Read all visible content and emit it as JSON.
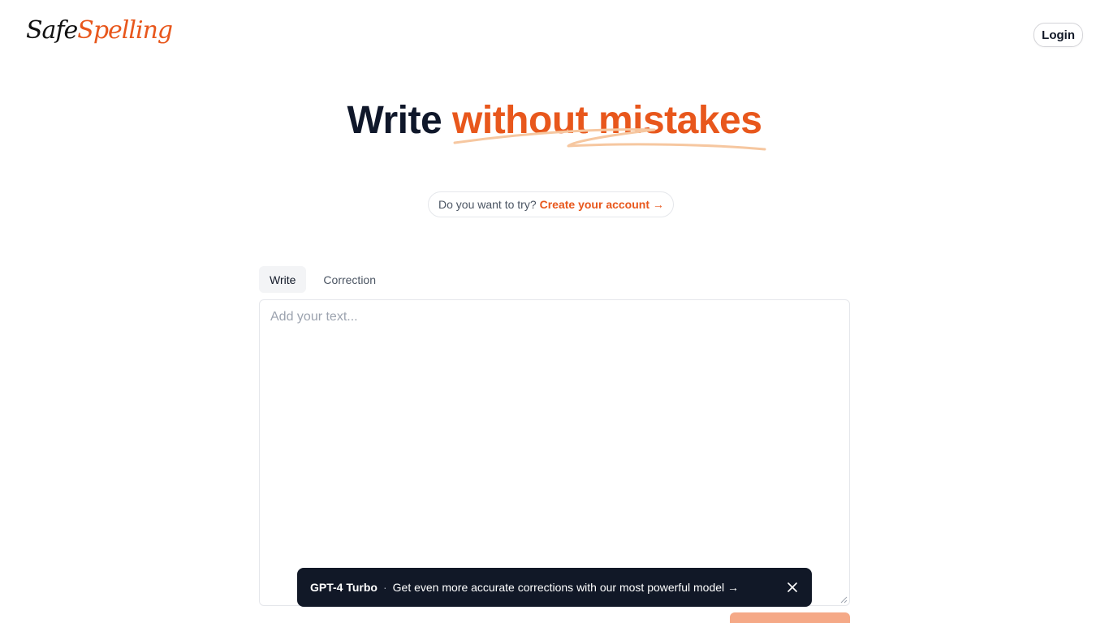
{
  "header": {
    "logo_part1": "Safe",
    "logo_part2": "Spelling",
    "login_label": "Login"
  },
  "hero": {
    "title_part1": "Write ",
    "title_part2": "without mistakes"
  },
  "cta": {
    "question": "Do you want to try?",
    "link_label": "Create your account →"
  },
  "tabs": [
    {
      "label": "Write",
      "active": true
    },
    {
      "label": "Correction",
      "active": false
    }
  ],
  "editor": {
    "placeholder": "Add your text..."
  },
  "toast": {
    "model": "GPT-4 Turbo",
    "separator": "·",
    "message": "Get even more accurate corrections with our most powerful model →"
  },
  "colors": {
    "accent": "#e8571c",
    "dark": "#0f172a",
    "toast_bg": "#111827",
    "submit_bg": "#f5a987"
  },
  "icons": {
    "toast_close": "close-icon",
    "resize": "resize-handle-icon"
  }
}
